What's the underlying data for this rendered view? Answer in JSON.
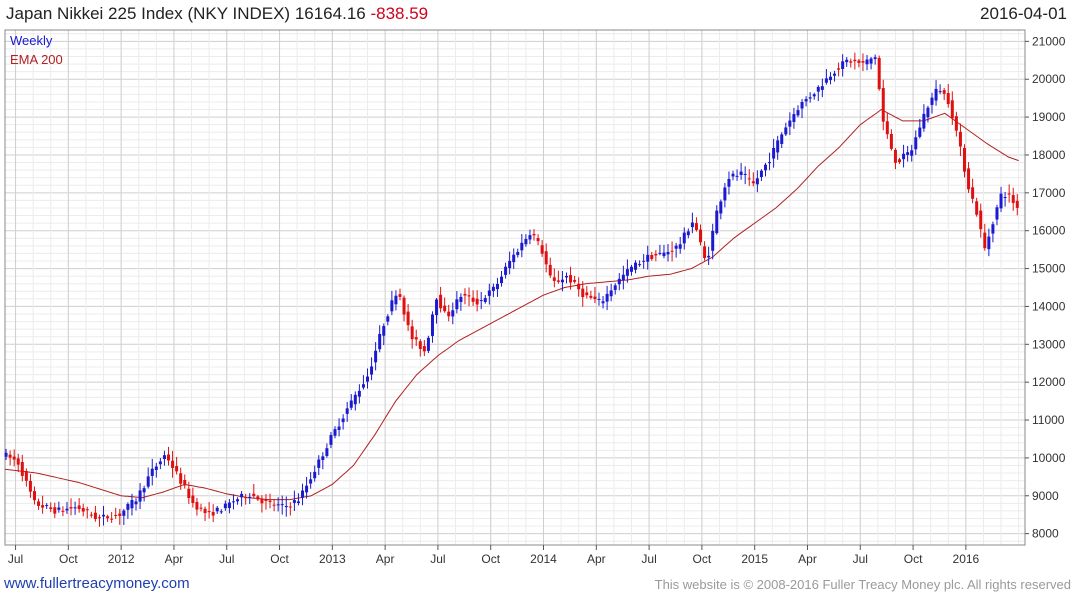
{
  "header": {
    "title": "Japan Nikkei 225 Index (NKY INDEX) 16164.16",
    "change": "-838.59",
    "date": "2016-04-01"
  },
  "footer": {
    "site": "www.fullertreacymoney.com",
    "copyright": "This website is © 2008-2016 Fuller Treacy Money plc. All rights reserved"
  },
  "colors": {
    "up": "#1a1ad0",
    "down": "#e01010",
    "ema": "#b22020",
    "grid": "#d8d8d8"
  },
  "chart_data": {
    "type": "line",
    "subtype": "weekly candlestick (high-low bars)",
    "legend": [
      "Weekly",
      "EMA 200"
    ],
    "legend_placement": "top-left",
    "grid": true,
    "y_axis_side": "right",
    "ylim": [
      7700,
      21300
    ],
    "yticks": [
      8000,
      9000,
      10000,
      11000,
      12000,
      13000,
      14000,
      15000,
      16000,
      17000,
      18000,
      19000,
      20000,
      21000
    ],
    "xlim": [
      2011.45,
      2016.28
    ],
    "xticks": [
      {
        "label": "Jul",
        "x": 2011.5
      },
      {
        "label": "Oct",
        "x": 2011.75
      },
      {
        "label": "2012",
        "x": 2012.0
      },
      {
        "label": "Apr",
        "x": 2012.25
      },
      {
        "label": "Jul",
        "x": 2012.5
      },
      {
        "label": "Oct",
        "x": 2012.75
      },
      {
        "label": "2013",
        "x": 2013.0
      },
      {
        "label": "Apr",
        "x": 2013.25
      },
      {
        "label": "Jul",
        "x": 2013.5
      },
      {
        "label": "Oct",
        "x": 2013.75
      },
      {
        "label": "2014",
        "x": 2014.0
      },
      {
        "label": "Apr",
        "x": 2014.25
      },
      {
        "label": "Jul",
        "x": 2014.5
      },
      {
        "label": "Oct",
        "x": 2014.75
      },
      {
        "label": "2015",
        "x": 2015.0
      },
      {
        "label": "Apr",
        "x": 2015.25
      },
      {
        "label": "Jul",
        "x": 2015.5
      },
      {
        "label": "Oct",
        "x": 2015.75
      },
      {
        "label": "2016",
        "x": 2016.0
      }
    ],
    "price_path": [
      [
        2011.25,
        9700
      ],
      [
        2011.35,
        9900
      ],
      [
        2011.45,
        10100
      ],
      [
        2011.52,
        9900
      ],
      [
        2011.6,
        8800
      ],
      [
        2011.7,
        8600
      ],
      [
        2011.8,
        8700
      ],
      [
        2011.9,
        8400
      ],
      [
        2012.0,
        8500
      ],
      [
        2012.08,
        8900
      ],
      [
        2012.15,
        9600
      ],
      [
        2012.22,
        10100
      ],
      [
        2012.28,
        9500
      ],
      [
        2012.35,
        8800
      ],
      [
        2012.42,
        8500
      ],
      [
        2012.5,
        8700
      ],
      [
        2012.55,
        8900
      ],
      [
        2012.62,
        9050
      ],
      [
        2012.7,
        8800
      ],
      [
        2012.78,
        8700
      ],
      [
        2012.85,
        8900
      ],
      [
        2012.9,
        9400
      ],
      [
        2013.0,
        10500
      ],
      [
        2013.08,
        11300
      ],
      [
        2013.18,
        12200
      ],
      [
        2013.25,
        13500
      ],
      [
        2013.32,
        14500
      ],
      [
        2013.38,
        13200
      ],
      [
        2013.45,
        12800
      ],
      [
        2013.5,
        14300
      ],
      [
        2013.55,
        13700
      ],
      [
        2013.62,
        14300
      ],
      [
        2013.7,
        14100
      ],
      [
        2013.78,
        14500
      ],
      [
        2013.85,
        15200
      ],
      [
        2013.95,
        16000
      ],
      [
        2014.0,
        15500
      ],
      [
        2014.05,
        14600
      ],
      [
        2014.12,
        14800
      ],
      [
        2014.2,
        14300
      ],
      [
        2014.28,
        14100
      ],
      [
        2014.35,
        14600
      ],
      [
        2014.42,
        15000
      ],
      [
        2014.5,
        15300
      ],
      [
        2014.58,
        15400
      ],
      [
        2014.65,
        15600
      ],
      [
        2014.72,
        16300
      ],
      [
        2014.78,
        15100
      ],
      [
        2014.83,
        16500
      ],
      [
        2014.88,
        17400
      ],
      [
        2014.95,
        17500
      ],
      [
        2015.0,
        17200
      ],
      [
        2015.08,
        17900
      ],
      [
        2015.15,
        18700
      ],
      [
        2015.22,
        19300
      ],
      [
        2015.3,
        19700
      ],
      [
        2015.38,
        20200
      ],
      [
        2015.45,
        20500
      ],
      [
        2015.52,
        20400
      ],
      [
        2015.58,
        20600
      ],
      [
        2015.62,
        18800
      ],
      [
        2015.68,
        17800
      ],
      [
        2015.75,
        18100
      ],
      [
        2015.82,
        19200
      ],
      [
        2015.88,
        19800
      ],
      [
        2015.93,
        19400
      ],
      [
        2015.97,
        18500
      ],
      [
        2016.02,
        17200
      ],
      [
        2016.06,
        16500
      ],
      [
        2016.1,
        15500
      ],
      [
        2016.14,
        16300
      ],
      [
        2016.18,
        17000
      ],
      [
        2016.22,
        16900
      ],
      [
        2016.25,
        16600
      ]
    ],
    "ema200_path": [
      [
        2011.45,
        9700
      ],
      [
        2011.6,
        9600
      ],
      [
        2011.8,
        9350
      ],
      [
        2012.0,
        9000
      ],
      [
        2012.1,
        8950
      ],
      [
        2012.2,
        9100
      ],
      [
        2012.3,
        9300
      ],
      [
        2012.4,
        9200
      ],
      [
        2012.5,
        9050
      ],
      [
        2012.6,
        8950
      ],
      [
        2012.7,
        8900
      ],
      [
        2012.8,
        8900
      ],
      [
        2012.9,
        9000
      ],
      [
        2013.0,
        9300
      ],
      [
        2013.1,
        9800
      ],
      [
        2013.2,
        10600
      ],
      [
        2013.3,
        11500
      ],
      [
        2013.4,
        12200
      ],
      [
        2013.5,
        12700
      ],
      [
        2013.6,
        13100
      ],
      [
        2013.7,
        13400
      ],
      [
        2013.8,
        13700
      ],
      [
        2013.9,
        14000
      ],
      [
        2014.0,
        14300
      ],
      [
        2014.1,
        14500
      ],
      [
        2014.2,
        14600
      ],
      [
        2014.3,
        14650
      ],
      [
        2014.4,
        14700
      ],
      [
        2014.5,
        14800
      ],
      [
        2014.6,
        14850
      ],
      [
        2014.7,
        15000
      ],
      [
        2014.8,
        15300
      ],
      [
        2014.9,
        15800
      ],
      [
        2015.0,
        16200
      ],
      [
        2015.1,
        16600
      ],
      [
        2015.2,
        17100
      ],
      [
        2015.3,
        17700
      ],
      [
        2015.4,
        18200
      ],
      [
        2015.5,
        18800
      ],
      [
        2015.55,
        19000
      ],
      [
        2015.6,
        19200
      ],
      [
        2015.7,
        18900
      ],
      [
        2015.8,
        18900
      ],
      [
        2015.9,
        19100
      ],
      [
        2016.0,
        18700
      ],
      [
        2016.1,
        18300
      ],
      [
        2016.2,
        17950
      ],
      [
        2016.25,
        17850
      ]
    ]
  }
}
